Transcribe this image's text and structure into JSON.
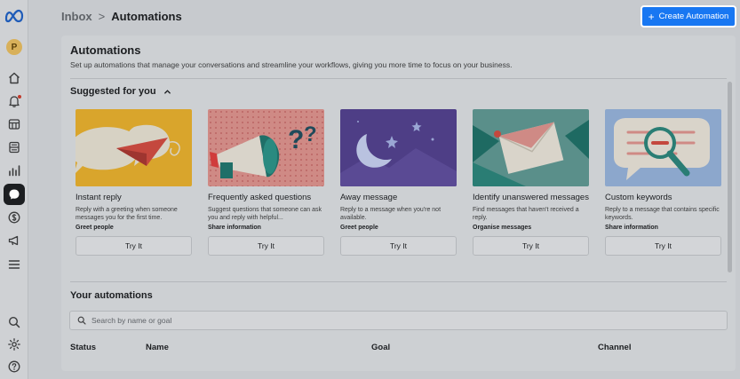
{
  "rail": {
    "avatar_letter": "P",
    "icons": [
      "home-icon",
      "bell-icon",
      "posts-icon",
      "content-icon",
      "insights-icon",
      "inbox-icon",
      "monetization-icon",
      "ads-icon",
      "menu-icon",
      "search-icon",
      "settings-icon",
      "help-icon"
    ]
  },
  "breadcrumb": {
    "parent": "Inbox",
    "separator": ">",
    "current": "Automations"
  },
  "header": {
    "create_label": "Create Automation"
  },
  "panel": {
    "title": "Automations",
    "subtitle": "Set up automations that manage your conversations and streamline your workflows, giving you more time to focus on your business.",
    "suggested_label": "Suggested for you"
  },
  "cards": [
    {
      "title": "Instant reply",
      "description": "Reply with a greeting when someone messages you for the first time.",
      "tag": "Greet people",
      "button": "Try It"
    },
    {
      "title": "Frequently asked questions",
      "description": "Suggest questions that someone can ask you and reply with helpful...",
      "tag": "Share information",
      "button": "Try It"
    },
    {
      "title": "Away message",
      "description": "Reply to a message when you're not available.",
      "tag": "Greet people",
      "button": "Try It"
    },
    {
      "title": "Identify unanswered messages",
      "description": "Find messages that haven't received a reply.",
      "tag": "Organise messages",
      "button": "Try It"
    },
    {
      "title": "Custom keywords",
      "description": "Reply to a message that contains specific keywords.",
      "tag": "Share information",
      "button": "Try It"
    }
  ],
  "your_automations": {
    "title": "Your automations",
    "search_placeholder": "Search by name or goal",
    "columns": [
      "Status",
      "Name",
      "Goal",
      "Channel"
    ]
  },
  "colors": {
    "accent": "#1877f2"
  }
}
